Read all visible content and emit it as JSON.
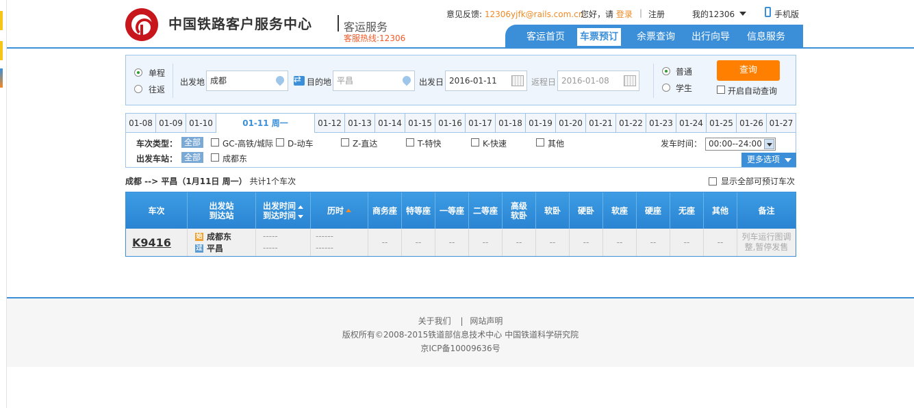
{
  "header": {
    "site_title": "中国铁路客户服务中心",
    "site_subtitle": "客运服务",
    "hotline": "客服热线:12306",
    "feedback_label": "意见反馈:",
    "feedback_email": "12306yjfk@rails.com.cn",
    "hello": "您好，请",
    "login": "登录",
    "sep": "|",
    "register": "注册",
    "my12306": "我的12306",
    "mobile": "手机版",
    "nav": [
      "客运首页",
      "车票预订",
      "余票查询",
      "出行向导",
      "信息服务"
    ],
    "nav_active": "车票预订"
  },
  "search": {
    "trip_one_way": "单程",
    "trip_round": "往返",
    "from_label": "出发地",
    "from_value": "成都",
    "to_label": "目的地",
    "to_value": "平昌",
    "depart_label": "出发日",
    "depart_value": "2016-01-11",
    "return_label": "返程日",
    "return_value": "2016-01-08",
    "ticket_normal": "普通",
    "ticket_student": "学生",
    "query_button": "查询",
    "auto_query": "开启自动查询"
  },
  "dates": [
    "01-08",
    "01-09",
    "01-10",
    "01-11  周一",
    "01-12",
    "01-13",
    "01-14",
    "01-15",
    "01-16",
    "01-17",
    "01-18",
    "01-19",
    "01-20",
    "01-21",
    "01-22",
    "01-23",
    "01-24",
    "01-25",
    "01-26",
    "01-27"
  ],
  "filters": {
    "train_type_label": "车次类型：",
    "all": "全部",
    "types": [
      "GC-高铁/城际",
      "D-动车",
      "Z-直达",
      "T-特快",
      "K-快速",
      "其他"
    ],
    "station_label": "出发车站：",
    "stations": [
      "成都东"
    ],
    "depart_time_label": "发车时间：",
    "depart_time_value": "00:00--24:00",
    "more_options": "更多选项"
  },
  "summary": {
    "route": "成都 --> 平昌（1月11日  周一）",
    "count": "共计1个车次",
    "show_all": "显示全部可预订车次"
  },
  "table": {
    "headers": {
      "train": "车次",
      "station_from": "出发站",
      "station_to": "到达站",
      "time_depart": "出发时间",
      "time_arrive": "到达时间",
      "duration": "历时",
      "business": "商务座",
      "special": "特等座",
      "first": "一等座",
      "second": "二等座",
      "adv_soft_sleeper_1": "高级",
      "adv_soft_sleeper_2": "软卧",
      "soft_sleeper": "软卧",
      "hard_sleeper": "硬卧",
      "soft_seat": "软座",
      "hard_seat": "硬座",
      "no_seat": "无座",
      "other": "其他",
      "remark": "备注"
    },
    "rows": [
      {
        "train_no": "K9416",
        "from_badge": "始",
        "from_station": "成都东",
        "to_badge": "过",
        "to_station": "平昌",
        "depart_time": "-----",
        "arrive_time": "-----",
        "duration_1": "------",
        "duration_2": "------",
        "seats": [
          "--",
          "--",
          "--",
          "--",
          "--",
          "--",
          "--",
          "--",
          "--",
          "--",
          "--"
        ],
        "remark_1": "列车运行图调",
        "remark_2": "整,暂停发售"
      }
    ]
  },
  "footer": {
    "about": "关于我们",
    "sep": "|",
    "statement": "网站声明",
    "copyright": "版权所有©2008-2015铁道部信息技术中心   中国铁道科学研究院",
    "icp": "京ICP备10009636号"
  },
  "colors": {
    "primary_blue": "#3b8fd8",
    "accent_orange": "#ff7f00",
    "brand_red": "#c8161d"
  }
}
